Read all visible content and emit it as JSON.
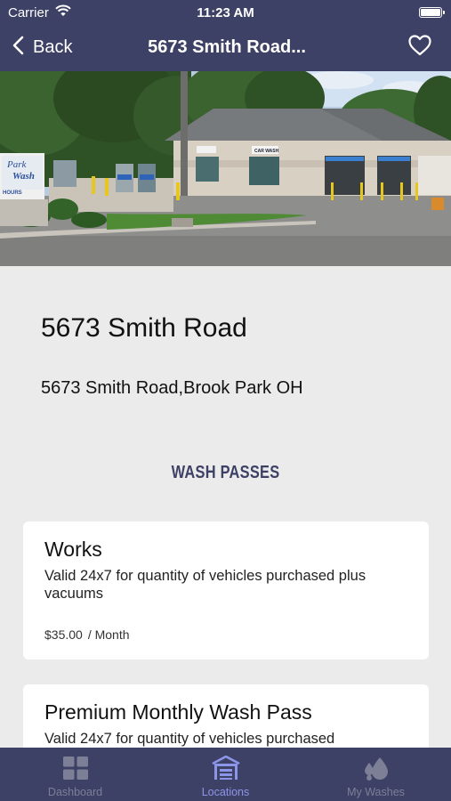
{
  "status": {
    "carrier": "Carrier",
    "time": "11:23 AM"
  },
  "nav": {
    "back_label": "Back",
    "title": "5673 Smith Road..."
  },
  "location": {
    "name": "5673 Smith Road",
    "address": "5673 Smith Road,Brook Park OH"
  },
  "photo": {
    "sign_text_1": "Park",
    "sign_text_2": "Wash",
    "sign_text_3": "HOURS",
    "building_sign": "CAR WASH"
  },
  "section_title": "WASH PASSES",
  "passes": [
    {
      "name": "Works",
      "description": "Valid 24x7 for quantity of vehicles purchased plus vacuums",
      "price": "$35.00",
      "period": "/ Month"
    },
    {
      "name": "Premium Monthly Wash Pass",
      "description": "Valid 24x7 for quantity of vehicles purchased",
      "price": "",
      "period": ""
    }
  ],
  "tabs": [
    {
      "label": "Dashboard",
      "icon": "dashboard-grid-icon",
      "active": false
    },
    {
      "label": "Locations",
      "icon": "car-wash-building-icon",
      "active": true
    },
    {
      "label": "My Washes",
      "icon": "water-drops-icon",
      "active": false
    }
  ],
  "colors": {
    "brand": "#3e4166",
    "background": "#ebebeb",
    "tab_active": "#8d95e8",
    "tab_inactive": "#7c7f96"
  }
}
